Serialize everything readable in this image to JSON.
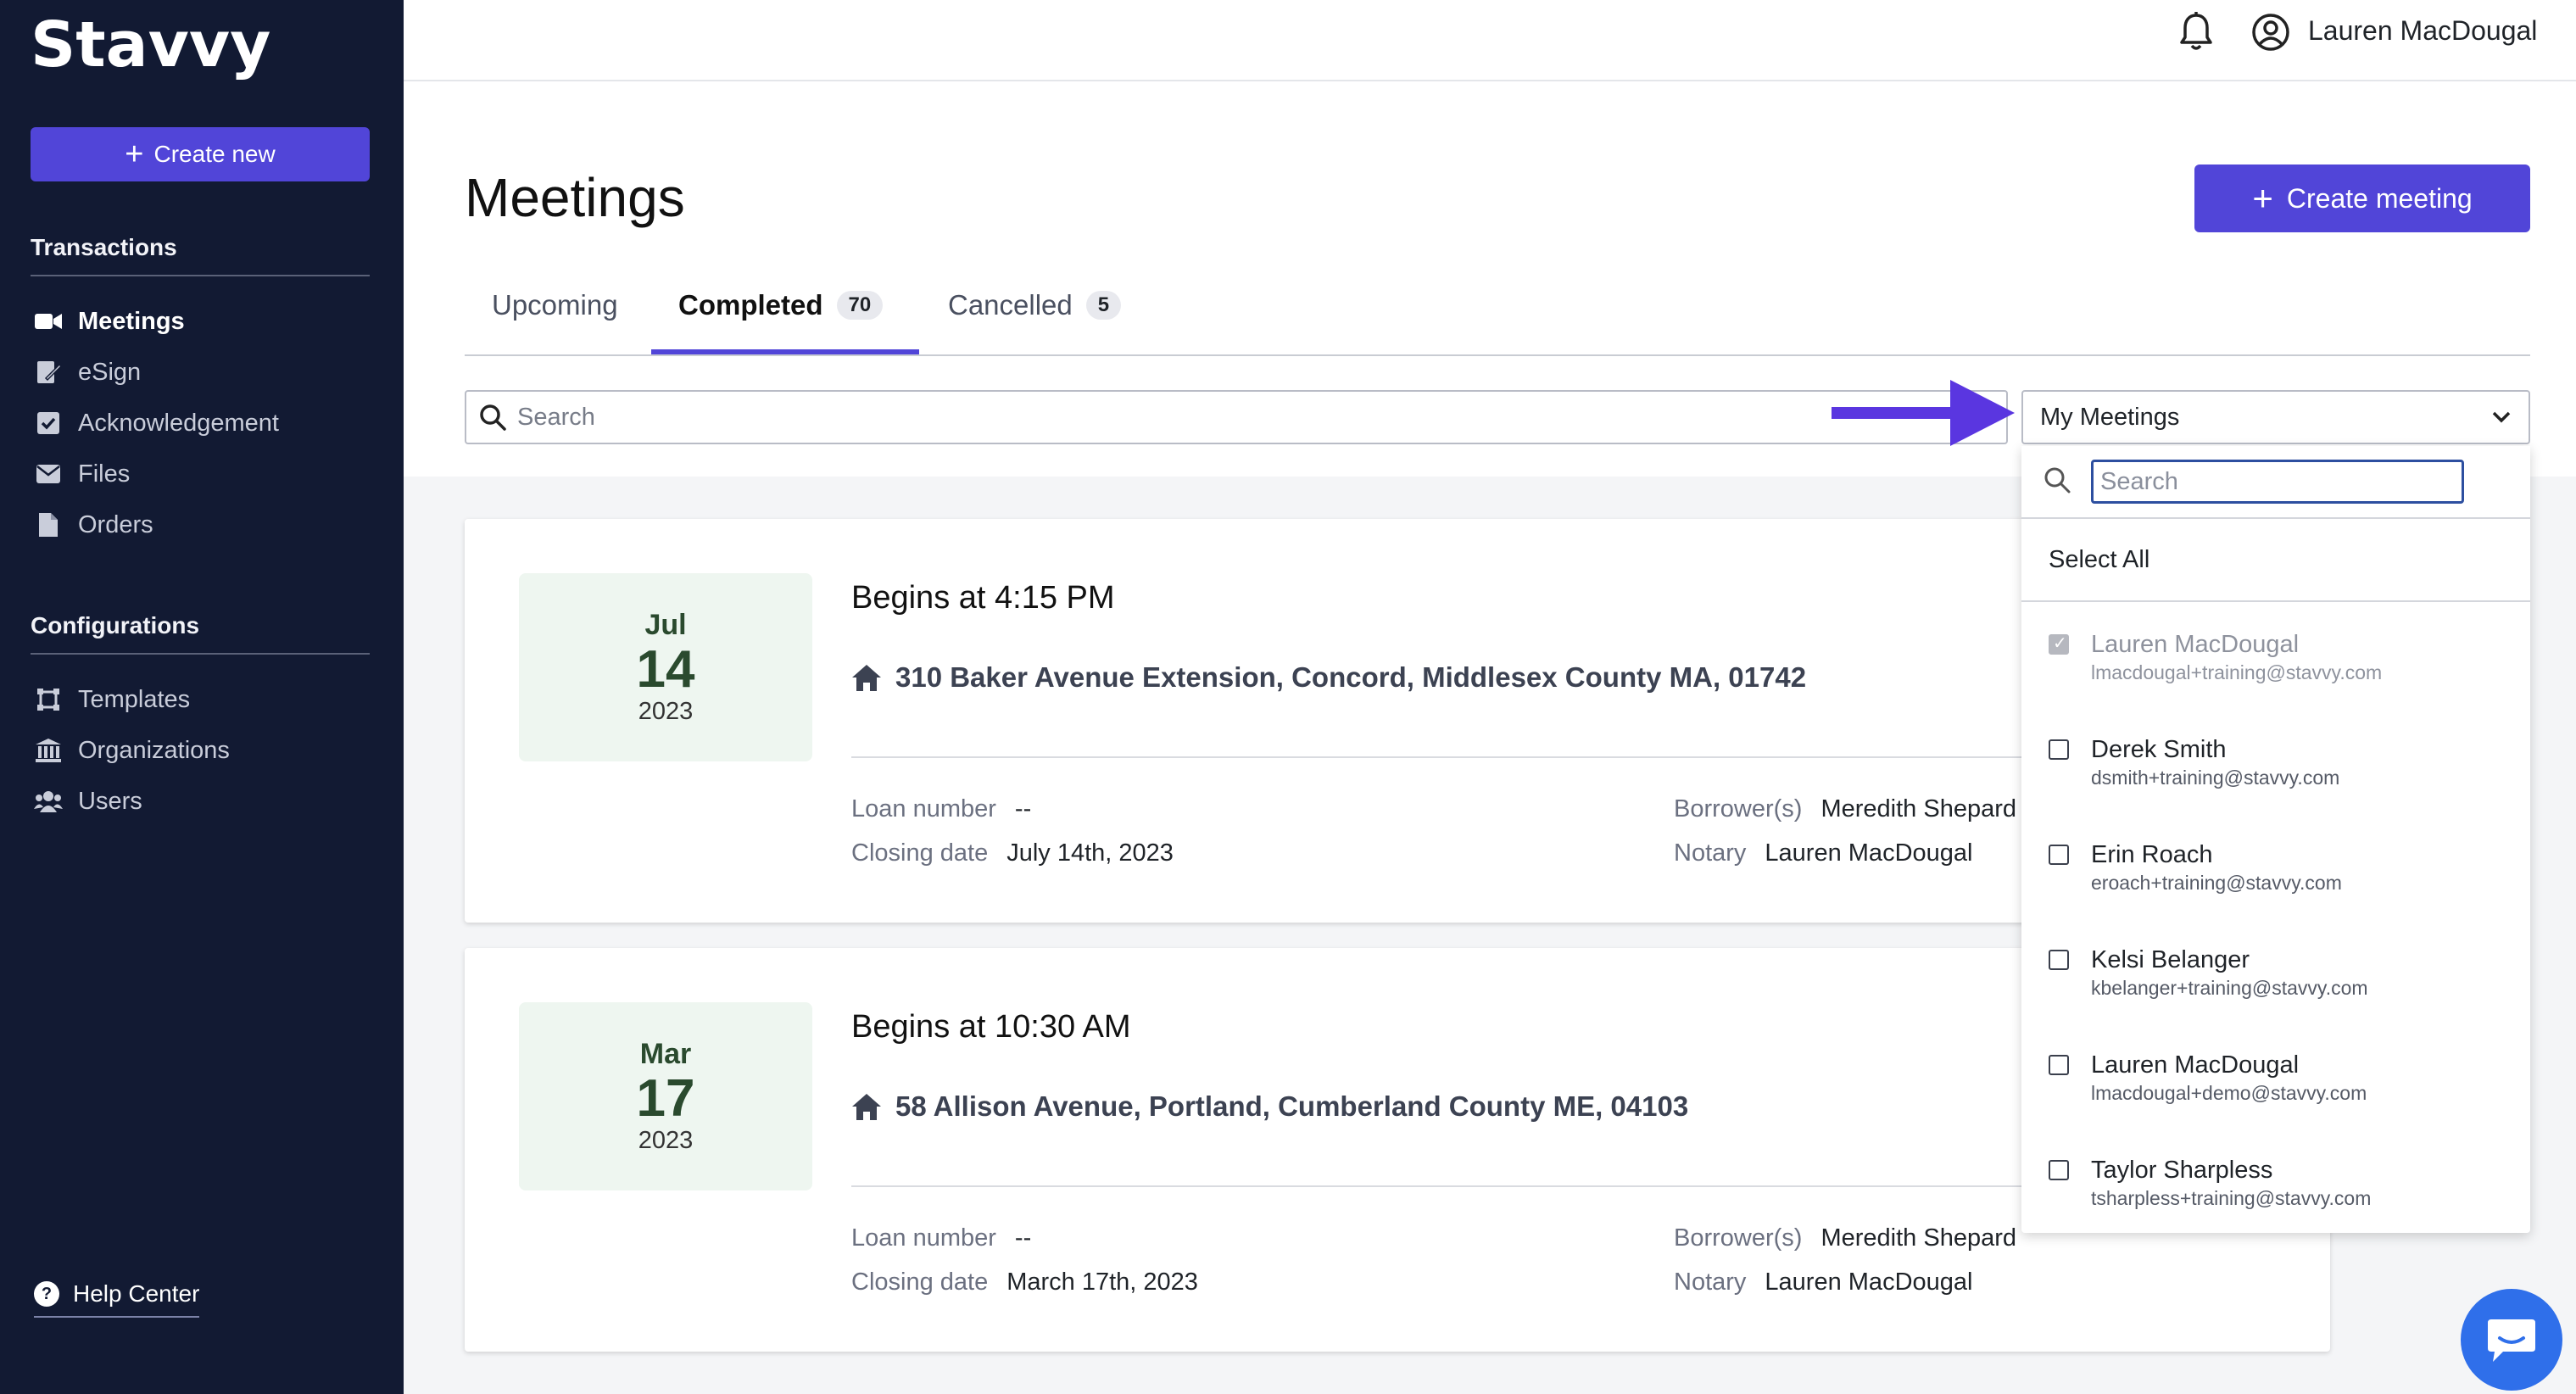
{
  "sidebar": {
    "logo_text": "Stavvy",
    "create_new": "Create new",
    "sections": [
      {
        "title": "Transactions",
        "items": [
          {
            "label": "Meetings",
            "icon": "video-camera-icon",
            "active": true
          },
          {
            "label": "eSign",
            "icon": "signature-icon"
          },
          {
            "label": "Acknowledgement",
            "icon": "checkbox-icon"
          },
          {
            "label": "Files",
            "icon": "envelope-icon"
          },
          {
            "label": "Orders",
            "icon": "document-icon"
          }
        ]
      },
      {
        "title": "Configurations",
        "items": [
          {
            "label": "Templates",
            "icon": "template-icon"
          },
          {
            "label": "Organizations",
            "icon": "building-icon"
          },
          {
            "label": "Users",
            "icon": "users-icon"
          }
        ]
      }
    ],
    "help": "Help Center"
  },
  "header": {
    "user_name": "Lauren MacDougal"
  },
  "main": {
    "title": "Meetings",
    "create_meeting": "Create meeting",
    "tabs": [
      {
        "label": "Upcoming"
      },
      {
        "label": "Completed",
        "count": "70",
        "active": true
      },
      {
        "label": "Cancelled",
        "count": "5"
      }
    ],
    "search_placeholder": "Search",
    "filter": {
      "selected": "My Meetings",
      "search_placeholder": "Search",
      "select_all": "Select All",
      "options": [
        {
          "name": "Lauren MacDougal",
          "email": "lmacdougal+training@stavvy.com",
          "checked": true,
          "disabled": true
        },
        {
          "name": "Derek Smith",
          "email": "dsmith+training@stavvy.com"
        },
        {
          "name": "Erin Roach",
          "email": "eroach+training@stavvy.com"
        },
        {
          "name": "Kelsi Belanger",
          "email": "kbelanger+training@stavvy.com"
        },
        {
          "name": "Lauren MacDougal",
          "email": "lmacdougal+demo@stavvy.com"
        },
        {
          "name": "Taylor Sharpless",
          "email": "tsharpless+training@stavvy.com"
        }
      ]
    },
    "meetings": [
      {
        "month": "Jul",
        "day": "14",
        "year": "2023",
        "begins": "Begins at 4:15 PM",
        "address": "310 Baker Avenue Extension, Concord, Middlesex County MA, 01742",
        "loan_label": "Loan number",
        "loan_value": "--",
        "closing_label": "Closing date",
        "closing_value": "July 14th, 2023",
        "borrower_label": "Borrower(s)",
        "borrower_value": "Meredith Shepard",
        "notary_label": "Notary",
        "notary_value": "Lauren MacDougal"
      },
      {
        "month": "Mar",
        "day": "17",
        "year": "2023",
        "begins": "Begins at 10:30 AM",
        "address": "58 Allison Avenue, Portland, Cumberland County ME, 04103",
        "loan_label": "Loan number",
        "loan_value": "--",
        "closing_label": "Closing date",
        "closing_value": "March 17th, 2023",
        "borrower_label": "Borrower(s)",
        "borrower_value": "Meredith Shepard",
        "notary_label": "Notary",
        "notary_value": "Lauren MacDougal"
      }
    ]
  },
  "colors": {
    "sidebar_bg": "#121a33",
    "accent": "#5145d8",
    "date_box_bg": "#eef6f0",
    "chat_button": "#2f6fea"
  }
}
